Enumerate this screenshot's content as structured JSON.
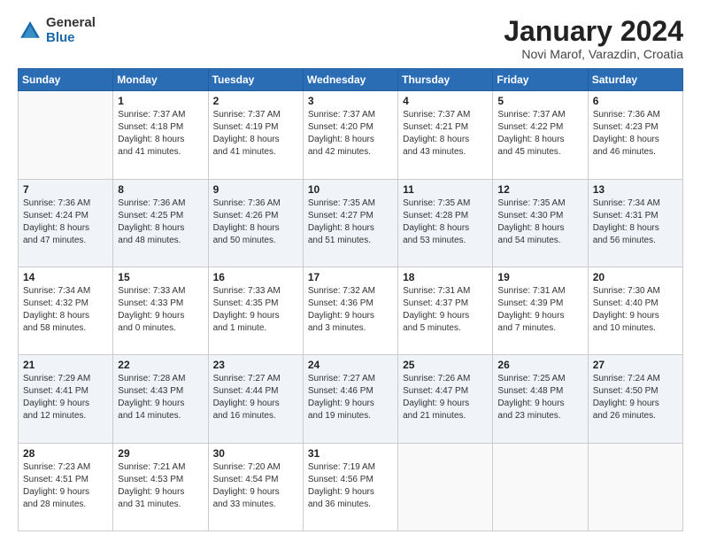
{
  "logo": {
    "general": "General",
    "blue": "Blue"
  },
  "title": "January 2024",
  "subtitle": "Novi Marof, Varazdin, Croatia",
  "headers": [
    "Sunday",
    "Monday",
    "Tuesday",
    "Wednesday",
    "Thursday",
    "Friday",
    "Saturday"
  ],
  "weeks": [
    [
      {
        "day": "",
        "info": ""
      },
      {
        "day": "1",
        "info": "Sunrise: 7:37 AM\nSunset: 4:18 PM\nDaylight: 8 hours\nand 41 minutes."
      },
      {
        "day": "2",
        "info": "Sunrise: 7:37 AM\nSunset: 4:19 PM\nDaylight: 8 hours\nand 41 minutes."
      },
      {
        "day": "3",
        "info": "Sunrise: 7:37 AM\nSunset: 4:20 PM\nDaylight: 8 hours\nand 42 minutes."
      },
      {
        "day": "4",
        "info": "Sunrise: 7:37 AM\nSunset: 4:21 PM\nDaylight: 8 hours\nand 43 minutes."
      },
      {
        "day": "5",
        "info": "Sunrise: 7:37 AM\nSunset: 4:22 PM\nDaylight: 8 hours\nand 45 minutes."
      },
      {
        "day": "6",
        "info": "Sunrise: 7:36 AM\nSunset: 4:23 PM\nDaylight: 8 hours\nand 46 minutes."
      }
    ],
    [
      {
        "day": "7",
        "info": "Sunrise: 7:36 AM\nSunset: 4:24 PM\nDaylight: 8 hours\nand 47 minutes."
      },
      {
        "day": "8",
        "info": "Sunrise: 7:36 AM\nSunset: 4:25 PM\nDaylight: 8 hours\nand 48 minutes."
      },
      {
        "day": "9",
        "info": "Sunrise: 7:36 AM\nSunset: 4:26 PM\nDaylight: 8 hours\nand 50 minutes."
      },
      {
        "day": "10",
        "info": "Sunrise: 7:35 AM\nSunset: 4:27 PM\nDaylight: 8 hours\nand 51 minutes."
      },
      {
        "day": "11",
        "info": "Sunrise: 7:35 AM\nSunset: 4:28 PM\nDaylight: 8 hours\nand 53 minutes."
      },
      {
        "day": "12",
        "info": "Sunrise: 7:35 AM\nSunset: 4:30 PM\nDaylight: 8 hours\nand 54 minutes."
      },
      {
        "day": "13",
        "info": "Sunrise: 7:34 AM\nSunset: 4:31 PM\nDaylight: 8 hours\nand 56 minutes."
      }
    ],
    [
      {
        "day": "14",
        "info": "Sunrise: 7:34 AM\nSunset: 4:32 PM\nDaylight: 8 hours\nand 58 minutes."
      },
      {
        "day": "15",
        "info": "Sunrise: 7:33 AM\nSunset: 4:33 PM\nDaylight: 9 hours\nand 0 minutes."
      },
      {
        "day": "16",
        "info": "Sunrise: 7:33 AM\nSunset: 4:35 PM\nDaylight: 9 hours\nand 1 minute."
      },
      {
        "day": "17",
        "info": "Sunrise: 7:32 AM\nSunset: 4:36 PM\nDaylight: 9 hours\nand 3 minutes."
      },
      {
        "day": "18",
        "info": "Sunrise: 7:31 AM\nSunset: 4:37 PM\nDaylight: 9 hours\nand 5 minutes."
      },
      {
        "day": "19",
        "info": "Sunrise: 7:31 AM\nSunset: 4:39 PM\nDaylight: 9 hours\nand 7 minutes."
      },
      {
        "day": "20",
        "info": "Sunrise: 7:30 AM\nSunset: 4:40 PM\nDaylight: 9 hours\nand 10 minutes."
      }
    ],
    [
      {
        "day": "21",
        "info": "Sunrise: 7:29 AM\nSunset: 4:41 PM\nDaylight: 9 hours\nand 12 minutes."
      },
      {
        "day": "22",
        "info": "Sunrise: 7:28 AM\nSunset: 4:43 PM\nDaylight: 9 hours\nand 14 minutes."
      },
      {
        "day": "23",
        "info": "Sunrise: 7:27 AM\nSunset: 4:44 PM\nDaylight: 9 hours\nand 16 minutes."
      },
      {
        "day": "24",
        "info": "Sunrise: 7:27 AM\nSunset: 4:46 PM\nDaylight: 9 hours\nand 19 minutes."
      },
      {
        "day": "25",
        "info": "Sunrise: 7:26 AM\nSunset: 4:47 PM\nDaylight: 9 hours\nand 21 minutes."
      },
      {
        "day": "26",
        "info": "Sunrise: 7:25 AM\nSunset: 4:48 PM\nDaylight: 9 hours\nand 23 minutes."
      },
      {
        "day": "27",
        "info": "Sunrise: 7:24 AM\nSunset: 4:50 PM\nDaylight: 9 hours\nand 26 minutes."
      }
    ],
    [
      {
        "day": "28",
        "info": "Sunrise: 7:23 AM\nSunset: 4:51 PM\nDaylight: 9 hours\nand 28 minutes."
      },
      {
        "day": "29",
        "info": "Sunrise: 7:21 AM\nSunset: 4:53 PM\nDaylight: 9 hours\nand 31 minutes."
      },
      {
        "day": "30",
        "info": "Sunrise: 7:20 AM\nSunset: 4:54 PM\nDaylight: 9 hours\nand 33 minutes."
      },
      {
        "day": "31",
        "info": "Sunrise: 7:19 AM\nSunset: 4:56 PM\nDaylight: 9 hours\nand 36 minutes."
      },
      {
        "day": "",
        "info": ""
      },
      {
        "day": "",
        "info": ""
      },
      {
        "day": "",
        "info": ""
      }
    ]
  ]
}
